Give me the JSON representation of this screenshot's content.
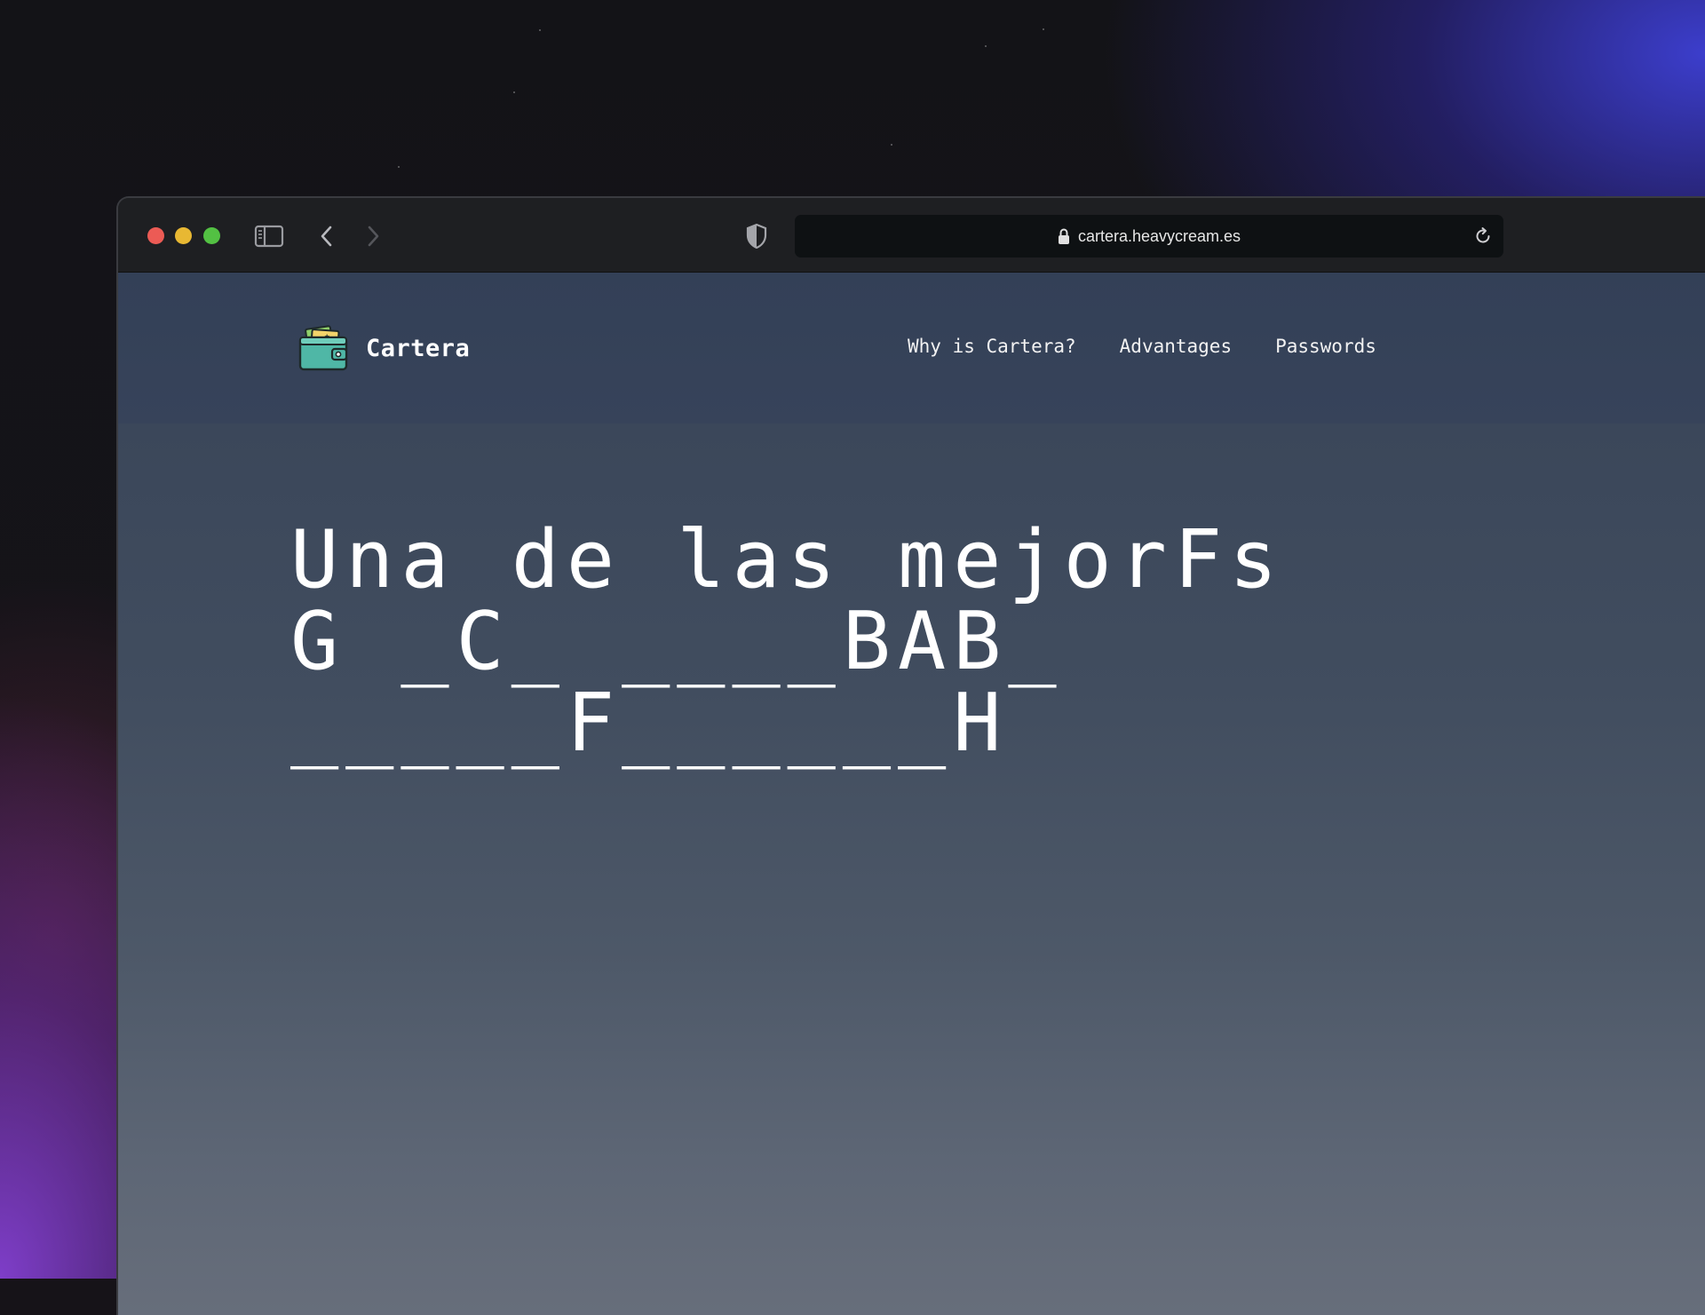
{
  "browser": {
    "url": "cartera.heavycream.es",
    "icons": {
      "sidebar": "sidebar-icon",
      "back": "chevron-left-icon",
      "forward": "chevron-right-icon",
      "privacy": "shield-icon",
      "lock": "lock-icon",
      "reload": "reload-icon"
    }
  },
  "site": {
    "brand": "Cartera",
    "logo_icon": "wallet-icon",
    "nav": [
      "Why is Cartera?",
      "Advantages",
      "Passwords"
    ],
    "hero_lines": [
      "Una de las mejorFs",
      "G _C_ ____BAB_",
      "_____F______H"
    ]
  },
  "colors": {
    "page_top": "#334057",
    "page_bottom": "#676e7b",
    "toolbar": "#1e1f22",
    "urlbar": "#0e1113",
    "wallet": "#4fb7a6"
  }
}
